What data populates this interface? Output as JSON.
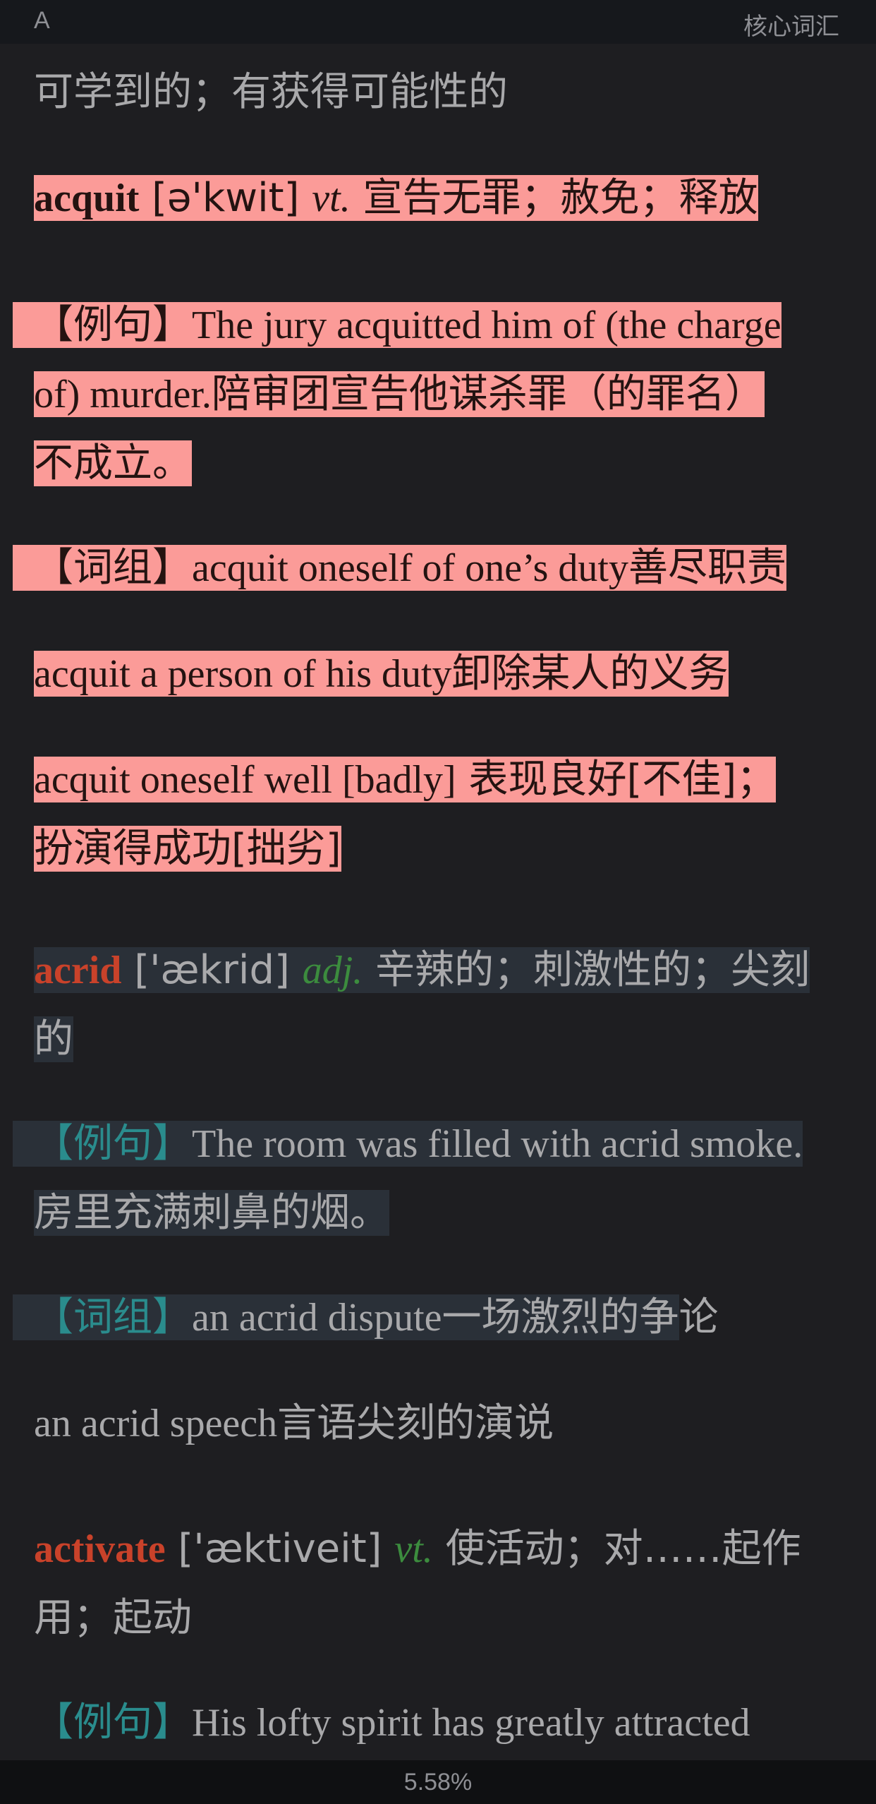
{
  "status_bar": {
    "left_label": "A",
    "right_label": "核心词汇"
  },
  "footer": {
    "progress_text": "5.58%"
  },
  "entries": {
    "prev_tail": "可学到的；有获得可能性的",
    "acquit": {
      "word": "acquit",
      "phonetic": "[ə'kwit]",
      "pos": "vt.",
      "meaning": "宣告无罪；赦免；释放",
      "example_label": "【例句】",
      "example_en_1": "The jury acquitted him of (the charge",
      "example_en_2": "of) murder.",
      "example_zh_2": "陪审团宣告他谋杀罪（的罪名）",
      "example_zh_3": "不成立。",
      "phrase_label": "【词组】",
      "phrase1_en": "acquit oneself of one’s duty",
      "phrase1_zh": "善尽职责",
      "phrase2_en": "acquit a person of his duty",
      "phrase2_zh": "卸除某人的义务",
      "phrase3_en": "acquit oneself well [badly]",
      "phrase3_zh_1": "表现良好[不佳]；",
      "phrase3_zh_2": "扮演得成功[拙劣]"
    },
    "acrid": {
      "word": "acrid",
      "phonetic": "['ækrid]",
      "pos": "adj.",
      "meaning_1": "辛辣的；刺激性的；尖刻",
      "meaning_2": "的",
      "example_label": "【例句】",
      "example_en": "The room was filled with acrid smoke.",
      "example_zh": "房里充满刺鼻的烟。",
      "phrase_label": "【词组】",
      "phrase1_en": "an acrid dispute",
      "phrase1_zh_hl": "一场激烈的争",
      "phrase1_zh_rest": "论",
      "phrase2_en": "an acrid speech",
      "phrase2_zh": "言语尖刻的演说"
    },
    "activate": {
      "word": "activate",
      "phonetic": "['æktiveit]",
      "pos": "vt.",
      "meaning_1": "使活动；对……起作",
      "meaning_2": "用；起动",
      "example_label": "【例句】",
      "example_en": "His lofty spirit has greatly attracted"
    }
  }
}
